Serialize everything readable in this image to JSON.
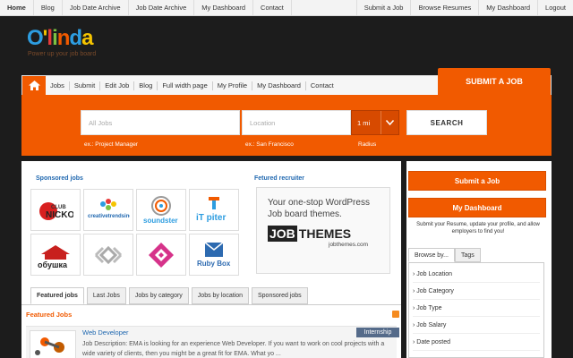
{
  "topbar": {
    "left": [
      "Home",
      "Blog",
      "Job Date Archive",
      "Job Date Archive",
      "My Dashboard",
      "Contact"
    ],
    "right": [
      "Submit a Job",
      "Browse Resumes",
      "My Dashboard",
      "Logout"
    ]
  },
  "logo": {
    "text": "O'linda",
    "tagline": "Power up your job board"
  },
  "nav": {
    "items": [
      "Jobs",
      "Submit",
      "Edit Job",
      "Blog",
      "Full width page",
      "My Profile",
      "My Dashboard",
      "Contact"
    ],
    "submit_tab": "SUBMIT A JOB"
  },
  "search": {
    "jobs_placeholder": "All Jobs",
    "location_placeholder": "Location",
    "radius_value": "1 mi",
    "button": "SEARCH",
    "jobs_hint": "ex.: Project Manager",
    "location_hint": "ex.: San Francisco",
    "radius_hint": "Radius"
  },
  "sponsored": {
    "heading": "Sponsored jobs",
    "logos": [
      "CLUB NICKO",
      "creativetrendsinc",
      "soundster",
      "iT piter",
      "обушка",
      "",
      "",
      "Ruby Box"
    ]
  },
  "featured_recruiter": {
    "heading": "Fetured recruiter",
    "line1": "Your one-stop WordPress",
    "line2": "Job board themes.",
    "brand_j": "JOB",
    "brand_t": "THEMES",
    "brand_url": "jobthemes.com"
  },
  "tabs": [
    "Featured jobs",
    "Last Jobs",
    "Jobs by category",
    "Jobs by location",
    "Sponsored jobs"
  ],
  "featured": {
    "title": "Featured Jobs",
    "job": {
      "name": "Web Developer",
      "type": "Internship",
      "desc": "Job Description: EMA is looking for an experience Web Developer. If you want to work on cool projects with a wide variety of clients, then you might be a great fit for EMA. What yo ..."
    }
  },
  "sidebar": {
    "submit_btn": "Submit a Job",
    "dashboard_btn": "My Dashboard",
    "note": "Submit your Resume, update your profile, and allow employers to find you!",
    "tabs": [
      "Browse by...",
      "Tags"
    ],
    "browse": [
      "Job Location",
      "Job Category",
      "Job Type",
      "Job Salary",
      "Date posted"
    ]
  },
  "colors": {
    "accent": "#f15a00",
    "link": "#2068b0",
    "background": "#1c1c1c"
  }
}
